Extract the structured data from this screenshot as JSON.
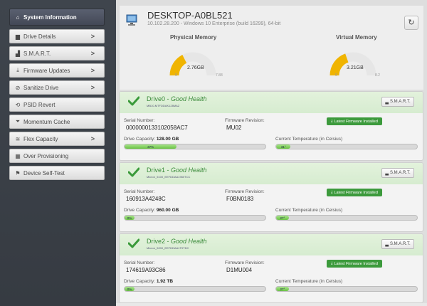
{
  "sidebar": {
    "items": [
      {
        "label": "System Information",
        "icon": "home-icon",
        "glyph": "⌂",
        "active": true,
        "chevron": false
      },
      {
        "label": "Drive Details",
        "icon": "drive-icon",
        "glyph": "▆",
        "active": false,
        "chevron": true
      },
      {
        "label": "S.M.A.R.T.",
        "icon": "chart-icon",
        "glyph": "▟",
        "active": false,
        "chevron": true
      },
      {
        "label": "Firmware Updates",
        "icon": "download-icon",
        "glyph": "⤓",
        "active": false,
        "chevron": true
      },
      {
        "label": "Sanitize Drive",
        "icon": "block-icon",
        "glyph": "⊘",
        "active": false,
        "chevron": true
      },
      {
        "label": "PSID Revert",
        "icon": "revert-icon",
        "glyph": "⟲",
        "active": false,
        "chevron": false
      },
      {
        "label": "Momentum Cache",
        "icon": "filter-icon",
        "glyph": "⏷",
        "active": false,
        "chevron": false
      },
      {
        "label": "Flex Capacity",
        "icon": "sliders-icon",
        "glyph": "≊",
        "active": false,
        "chevron": true
      },
      {
        "label": "Over Provisioning",
        "icon": "grid-icon",
        "glyph": "▦",
        "active": false,
        "chevron": false
      },
      {
        "label": "Device Self-Test",
        "icon": "flag-icon",
        "glyph": "⚑",
        "active": false,
        "chevron": false
      }
    ],
    "chevron_glyph": ">"
  },
  "header": {
    "hostname": "DESKTOP-A0BL521",
    "system": "10.102.28.200 - Windows 10 Enterprise (build 16299), 64-bit",
    "refresh_icon": "refresh-icon",
    "refresh_glyph": "↻"
  },
  "gauges": [
    {
      "title": "Physical Memory",
      "value_label": "2.76GB",
      "value": 2.76,
      "max": 7.88,
      "min_label": "0",
      "max_label": "7.88"
    },
    {
      "title": "Virtual Memory",
      "value_label": "3.21GB",
      "value": 3.21,
      "max": 8.2,
      "min_label": "0",
      "max_label": "8.2"
    }
  ],
  "drives": [
    {
      "name": "Drive0",
      "health": "Good Health",
      "model": "MB10-MTFDDAK128MAZ",
      "serial_label": "Serial Number:",
      "serial": "0000000133102058AC7",
      "fw_label": "Firmware Revision:",
      "fw": "MU02",
      "fw_badge": "Latest Firmware Installed",
      "capacity_label": "Drive Capacity:",
      "capacity": "128.00 GB",
      "capacity_pct": 37,
      "capacity_pct_label": "37%",
      "temp_label": "Current Temperature (in Celsius)",
      "temp_label_value": "31°",
      "temp": 31,
      "smart_label": "S.M.A.R.T."
    },
    {
      "name": "Drive1",
      "health": "Good Health",
      "model": "Micron_5100_EEFDDAA1960TCC",
      "serial_label": "Serial Number:",
      "serial": "160913A4248C",
      "fw_label": "Firmware Revision:",
      "fw": "F0BN0183",
      "fw_badge": "Latest Firmware Installed",
      "capacity_label": "Drive Capacity:",
      "capacity": "960.00 GB",
      "capacity_pct": 0,
      "capacity_pct_label": "0%",
      "temp_label": "Current Temperature (in Celsius)",
      "temp_label_value": "27°",
      "temp": 27,
      "smart_label": "S.M.A.R.T."
    },
    {
      "name": "Drive2",
      "health": "Good Health",
      "model": "Micron_5200_EEFDDAA1T9TDC",
      "serial_label": "Serial Number:",
      "serial": "174619A93C86",
      "fw_label": "Firmware Revision:",
      "fw": "D1MU004",
      "fw_badge": "Latest Firmware Installed",
      "capacity_label": "Drive Capacity:",
      "capacity": "1.92 TB",
      "capacity_pct": 0,
      "capacity_pct_label": "0%",
      "temp_label": "Current Temperature (in Celsius)",
      "temp_label_value": "27°",
      "temp": 27,
      "smart_label": "S.M.A.R.T."
    }
  ],
  "colors": {
    "gauge_fill": "#f0b400",
    "health_green": "#3a8a3a",
    "badge_green": "#3c9a3c"
  }
}
